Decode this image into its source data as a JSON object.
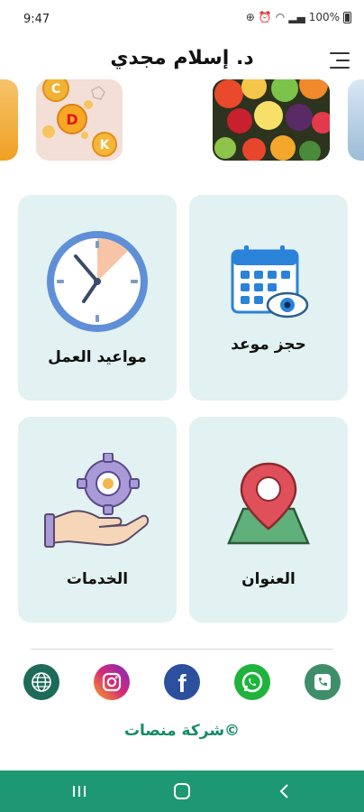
{
  "status_bar": {
    "time": "9:47",
    "battery": "100%"
  },
  "header": {
    "title": "د. إسلام مجدي",
    "menu_icon": "menu-icon"
  },
  "carousel": {
    "slides": [
      {
        "name": "orange-juice-slide"
      },
      {
        "name": "vitamins-slide",
        "letters": [
          "C",
          "D",
          "K"
        ]
      },
      {
        "name": "fruit-slide"
      },
      {
        "name": "next-slide"
      }
    ]
  },
  "cards": [
    {
      "id": "book-appointment",
      "label": "حجز موعد",
      "icon": "calendar-eye-icon"
    },
    {
      "id": "working-hours",
      "label": "مواعيد العمل",
      "icon": "clock-icon"
    },
    {
      "id": "address",
      "label": "العنوان",
      "icon": "map-pin-icon"
    },
    {
      "id": "services",
      "label": "الخدمات",
      "icon": "hand-gear-icon"
    }
  ],
  "social": [
    {
      "name": "phone-icon",
      "color": "#3f8e6a"
    },
    {
      "name": "whatsapp-icon",
      "color": "#1fb33d"
    },
    {
      "name": "facebook-icon",
      "color": "#2c4f9e"
    },
    {
      "name": "instagram-icon",
      "color": "#c8348a"
    },
    {
      "name": "website-icon",
      "color": "#1d6b58"
    }
  ],
  "footer": {
    "copyright": "©شركة منصات"
  },
  "colors": {
    "card_bg": "#e2f1f1",
    "accent_green": "#1e9872",
    "copyright_green": "#168a68"
  }
}
